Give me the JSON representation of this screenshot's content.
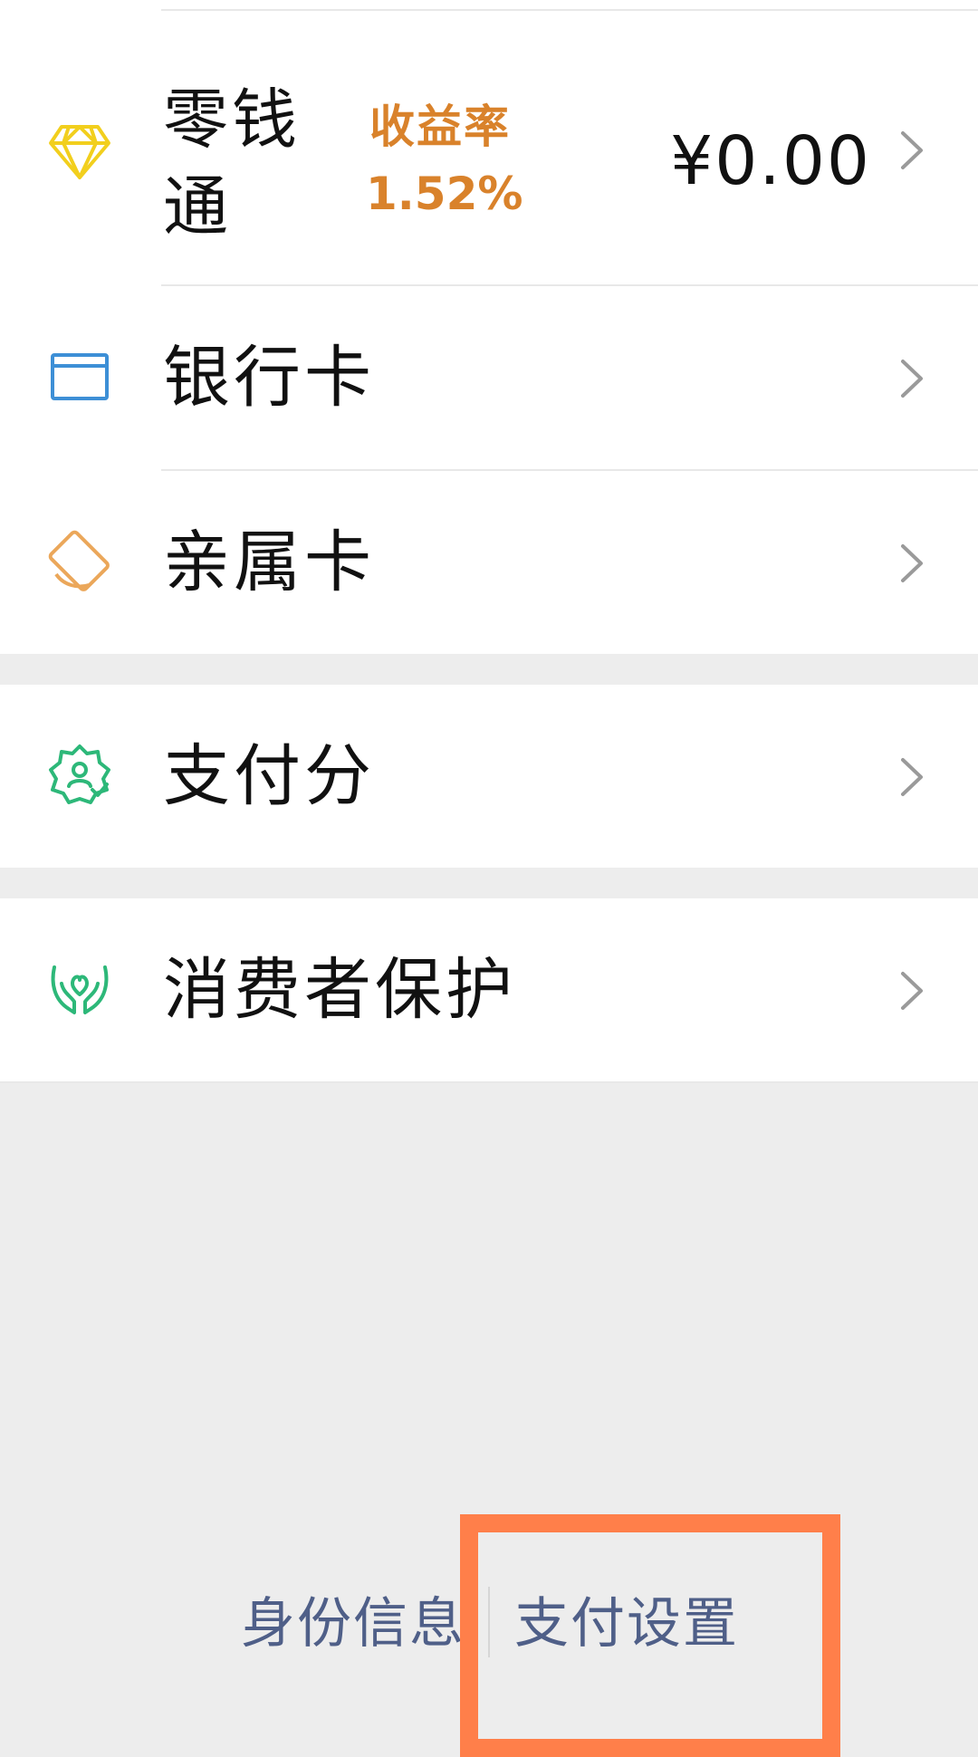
{
  "wallet_list": {
    "items": [
      {
        "label": "零钱通",
        "icon": "diamond-icon",
        "icon_color": "#f2cf1d",
        "yield_title": "收益率",
        "yield_value": "1.52%",
        "balance": "¥0.00"
      },
      {
        "label": "银行卡",
        "icon": "bank-card-icon",
        "icon_color": "#3d8fd6"
      },
      {
        "label": "亲属卡",
        "icon": "family-card-icon",
        "icon_color": "#eba75a"
      },
      {
        "label": "支付分",
        "icon": "pay-score-icon",
        "icon_color": "#2db879"
      },
      {
        "label": "消费者保护",
        "icon": "consumer-protection-icon",
        "icon_color": "#2db879"
      }
    ]
  },
  "footer": {
    "identity_label": "身份信息",
    "settings_label": "支付设置"
  },
  "colors": {
    "accent_yield": "#d9822b",
    "footer_link": "#4f5f88",
    "highlight": "#ff7f4a",
    "background": "#ededed"
  }
}
